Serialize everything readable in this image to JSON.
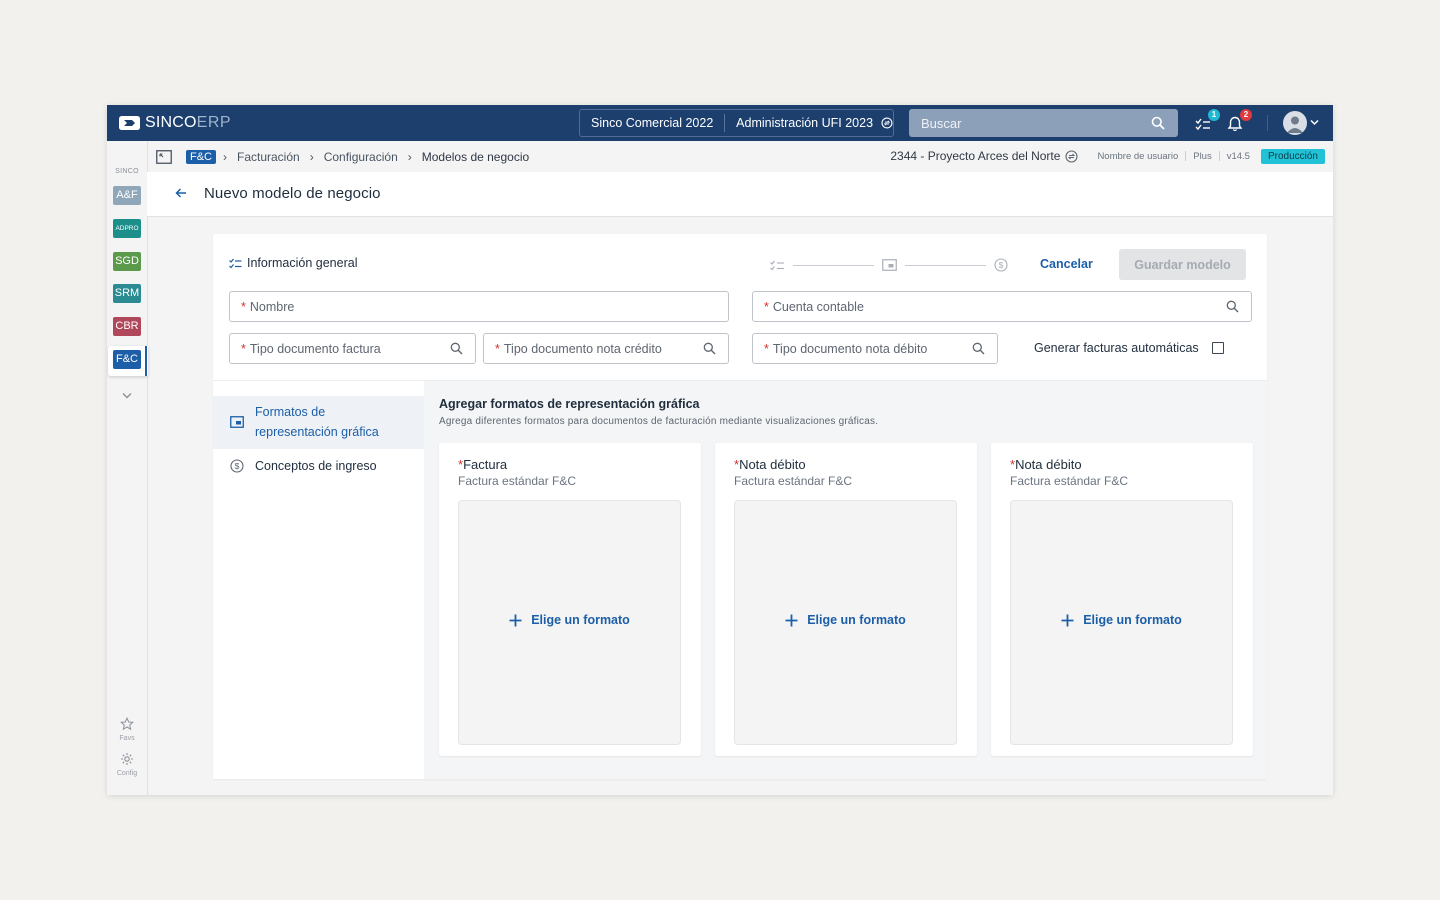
{
  "app": {
    "brand_primary": "SINCO",
    "brand_secondary": "ERP",
    "context": {
      "company": "Sinco Comercial 2022",
      "unit": "Administración UFI 2023"
    },
    "search": {
      "placeholder": "Buscar"
    },
    "notifications": {
      "tasks_count": "1",
      "alerts_count": "2"
    },
    "colors": {
      "topbar": "#1c3f6e",
      "accent": "#1c5fa8",
      "required": "#d0342c",
      "env": "#21c1d6"
    }
  },
  "rail": {
    "title": "SINCO",
    "modules": [
      {
        "label": "A&F",
        "color": "#8fa7b9"
      },
      {
        "label": "ADPRO",
        "color": "#1c8f8b"
      },
      {
        "label": "SGD",
        "color": "#5a9a4a"
      },
      {
        "label": "SRM",
        "color": "#2a8b92"
      },
      {
        "label": "CBR",
        "color": "#b1475a"
      },
      {
        "label": "F&C",
        "color": "#1c5fa8"
      }
    ],
    "favs_label": "Favs",
    "config_label": "Config"
  },
  "breadcrumb": {
    "module_tag": "F&C",
    "items": [
      "Facturación",
      "Configuración",
      "Modelos de negocio"
    ],
    "project": "2344 - Proyecto Arces del Norte",
    "username": "Nombre de usuario",
    "plan": "Plus",
    "version": "v14.5",
    "environment": "Producción"
  },
  "header": {
    "title": "Nuevo modelo de negocio"
  },
  "form": {
    "section_label": "Información general",
    "cancel_label": "Cancelar",
    "save_label": "Guardar modelo",
    "fields": {
      "nombre": "Nombre",
      "cuenta": "Cuenta contable",
      "tipo_factura": "Tipo documento factura",
      "tipo_credito": "Tipo documento nota crédito",
      "tipo_debito": "Tipo documento nota débito"
    },
    "required_mark": "*",
    "auto_invoices_label": "Generar facturas automáticas"
  },
  "tabs": {
    "formatos": "Formatos de representación gráfica",
    "conceptos": "Conceptos de ingreso"
  },
  "content": {
    "title": "Agregar formatos de representación gráfica",
    "description": "Agrega diferentes formatos para documentos de facturación mediante visualizaciones gráficas.",
    "cards": [
      {
        "title": "Factura",
        "subtitle": "Factura estándar F&C",
        "action": "Elige un formato"
      },
      {
        "title": "Nota débito",
        "subtitle": "Factura estándar F&C",
        "action": "Elige un formato"
      },
      {
        "title": "Nota débito",
        "subtitle": "Factura estándar F&C",
        "action": "Elige un formato"
      }
    ]
  }
}
